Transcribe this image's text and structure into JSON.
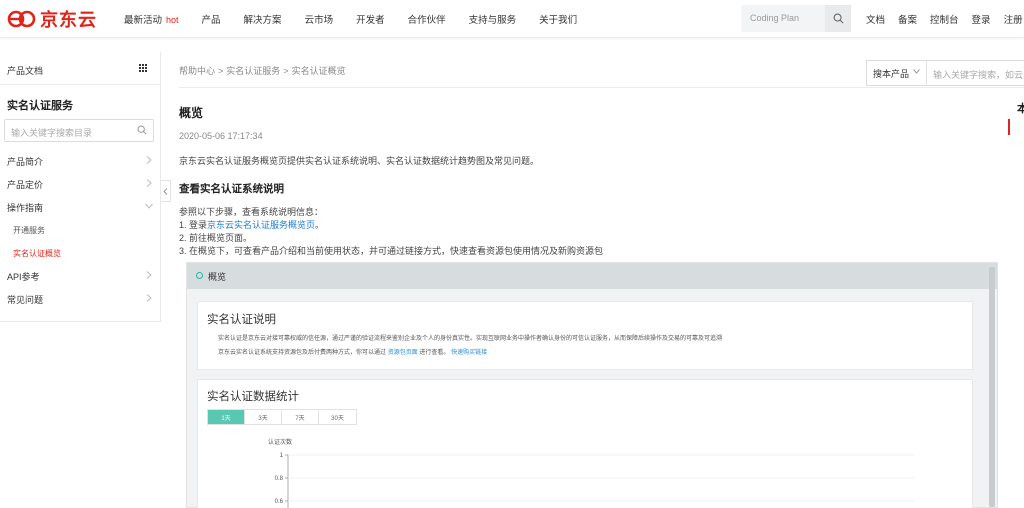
{
  "header": {
    "logo_text": "京东云",
    "nav": [
      {
        "label": "最新活动",
        "hot": "hot"
      },
      {
        "label": "产品"
      },
      {
        "label": "解决方案"
      },
      {
        "label": "云市场"
      },
      {
        "label": "开发者"
      },
      {
        "label": "合作伙伴"
      },
      {
        "label": "支持与服务"
      },
      {
        "label": "关于我们"
      }
    ],
    "search_placeholder": "Coding Plan",
    "right_links": [
      "文档",
      "备案",
      "控制台",
      "登录",
      "注册"
    ],
    "brand_color": "#e2231a"
  },
  "sidebar": {
    "header": "产品文档",
    "title": "实名认证服务",
    "search_placeholder": "输入关键字搜索目录",
    "items": [
      {
        "label": "产品简介"
      },
      {
        "label": "产品定价"
      },
      {
        "label": "操作指南"
      },
      {
        "label": "API参考"
      },
      {
        "label": "常见问题"
      }
    ],
    "sub_items": [
      {
        "label": "开通服务"
      },
      {
        "label": "实名认证概览",
        "active": true
      }
    ]
  },
  "breadcrumb": [
    "帮助中心",
    "实名认证服务",
    "实名认证概览"
  ],
  "main_search": {
    "select": "搜本产品",
    "placeholder": "输入关键字搜索，如云主机"
  },
  "article": {
    "title": "概览",
    "date": "2020-05-06 17:17:34",
    "desc": "京东云实名认证服务概览页提供实名认证系统说明、实名认证数据统计趋势图及常见问题。",
    "section_title": "查看实名认证系统说明",
    "steps_intro": "参照以下步骤，查看系统说明信息：",
    "step1_prefix": "1. 登录",
    "step1_link": "京东云实名认证服务概览页",
    "step1_suffix": "。",
    "step2": "2. 前往概览页面。",
    "step3": "3. 在概览下，可查看产品介绍和当前使用状态，并可通过链接方式，快速查看资源包使用情况及新购资源包"
  },
  "toc": {
    "title": "本"
  },
  "screenshot": {
    "header": "概览",
    "card1_title": "实名认证说明",
    "card1_line1": "实名认证是京东云对接可靠权威的信任源，通过严谨的验证流程来鉴别企业及个人的身份真实性。实现互联网业务中操作者确认身份的可信认证服务，从而保障后续操作及交易的可靠及可追溯",
    "card1_line2_prefix": "京东云实名认证系统支持资源包及后付费两种方式，你可以通过",
    "card1_line2_link1": "资源包页面",
    "card1_line2_mid": "进行查看。",
    "card1_line2_link2": "快速购买链接",
    "card2_title": "实名认证数据统计",
    "tabs": [
      "1天",
      "3天",
      "7天",
      "30天"
    ],
    "active_tab": 0,
    "accent": "#58c9b0"
  },
  "chart_data": {
    "type": "line",
    "ylabel": "认证次数",
    "y_ticks": [
      1,
      0.8,
      0.6
    ],
    "ylim": [
      0.6,
      1
    ],
    "series": [],
    "grid": true
  }
}
